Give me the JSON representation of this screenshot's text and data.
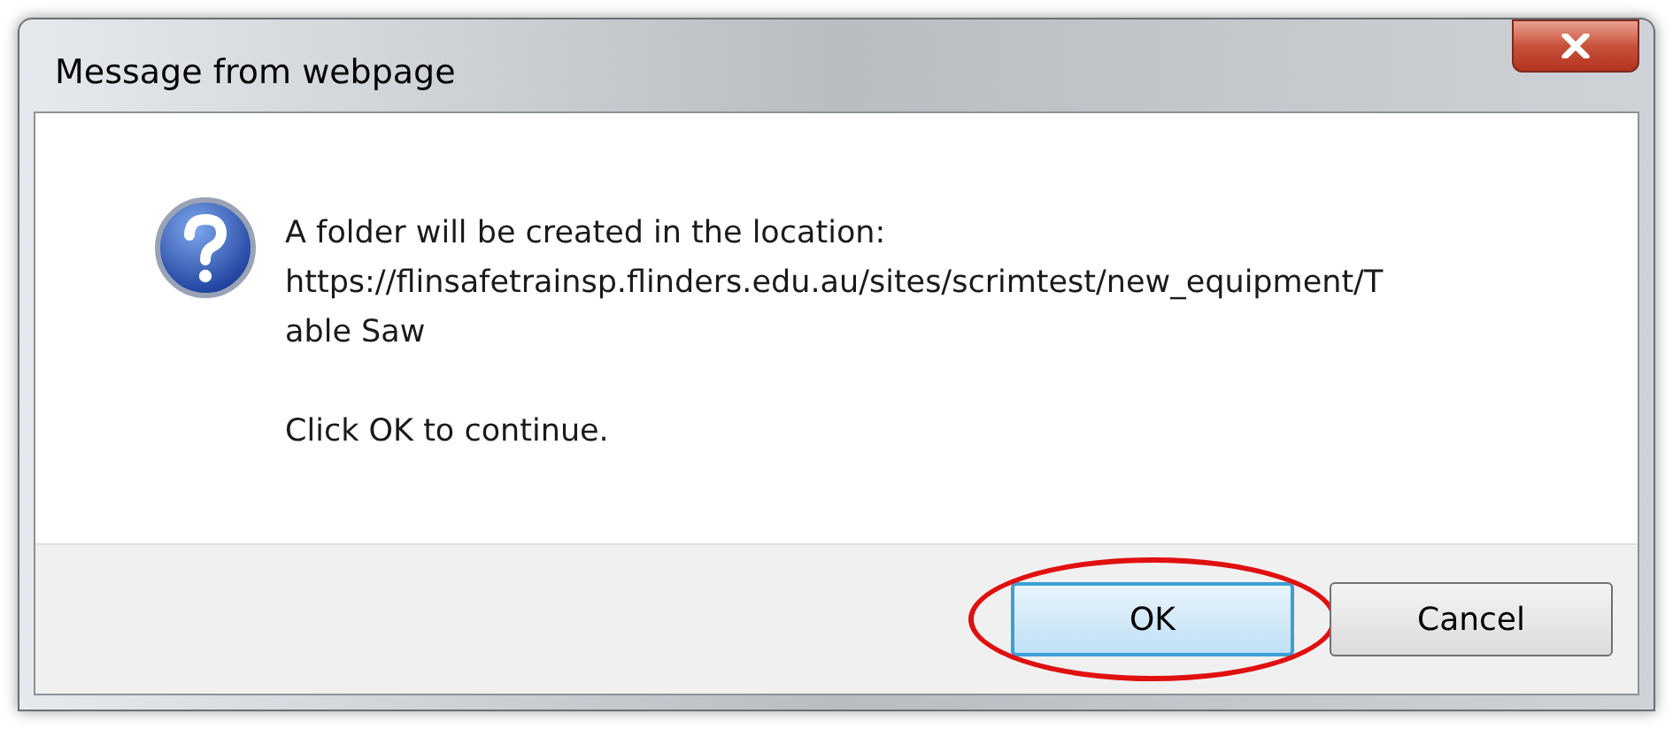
{
  "window": {
    "title": "Message from webpage"
  },
  "message": {
    "lines": [
      "A folder will be created in the location:",
      "https://flinsafetrainsp.flinders.edu.au/sites/scrimtest/new_equipment/T",
      "able Saw"
    ],
    "note": "Click OK to continue."
  },
  "buttons": [
    {
      "label": "OK",
      "default": true,
      "circled": true
    },
    {
      "label": "Cancel",
      "default": false,
      "circled": false
    }
  ]
}
